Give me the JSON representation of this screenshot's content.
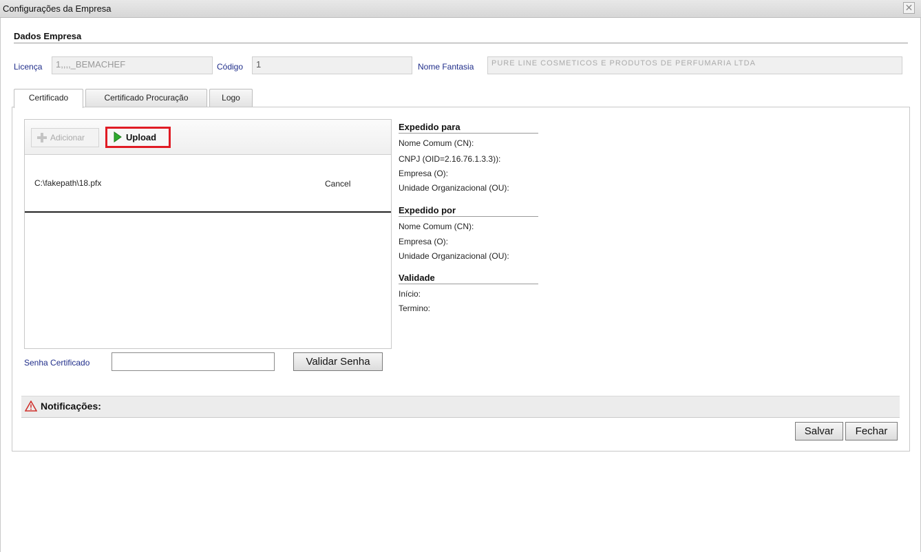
{
  "window": {
    "title": "Configurações da Empresa",
    "close_glyph": "✕"
  },
  "section": {
    "title": "Dados Empresa"
  },
  "fields": {
    "licenca": {
      "label": "Licença",
      "value": "1,,,,_BEMACHEF"
    },
    "codigo": {
      "label": "Código",
      "value": "1"
    },
    "nome_fantasia": {
      "label": "Nome Fantasia",
      "value": "PURE LINE COSMETICOS E PRODUTOS DE PERFUMARIA LTDA"
    }
  },
  "tabs": [
    {
      "label": "Certificado",
      "active": true
    },
    {
      "label": "Certificado Procuração",
      "active": false
    },
    {
      "label": "Logo",
      "active": false
    }
  ],
  "upload": {
    "add_label": "Adicionar",
    "upload_label": "Upload",
    "file_name": "C:\\fakepath\\18.pfx",
    "cancel_label": "Cancel"
  },
  "info": {
    "expedido_para": {
      "title": "Expedido para",
      "items": [
        "Nome Comum (CN):",
        "CNPJ (OID=2.16.76.1.3.3)):",
        "Empresa (O):",
        "Unidade Organizacional (OU):"
      ]
    },
    "expedido_por": {
      "title": "Expedido por",
      "items": [
        "Nome Comum (CN):",
        "Empresa (O):",
        "Unidade Organizacional (OU):"
      ]
    },
    "validade": {
      "title": "Validade",
      "items": [
        "Início:",
        "Termino:"
      ]
    }
  },
  "password": {
    "label": "Senha Certificado",
    "value": "",
    "validate_label": "Validar Senha"
  },
  "notifications": {
    "label": "Notificações:"
  },
  "footer": {
    "save_label": "Salvar",
    "close_label": "Fechar"
  },
  "colors": {
    "label_blue": "#1f2d8a",
    "highlight_red": "#e01b24",
    "upload_green": "#2eaa2e",
    "warning_red": "#d0312d"
  }
}
